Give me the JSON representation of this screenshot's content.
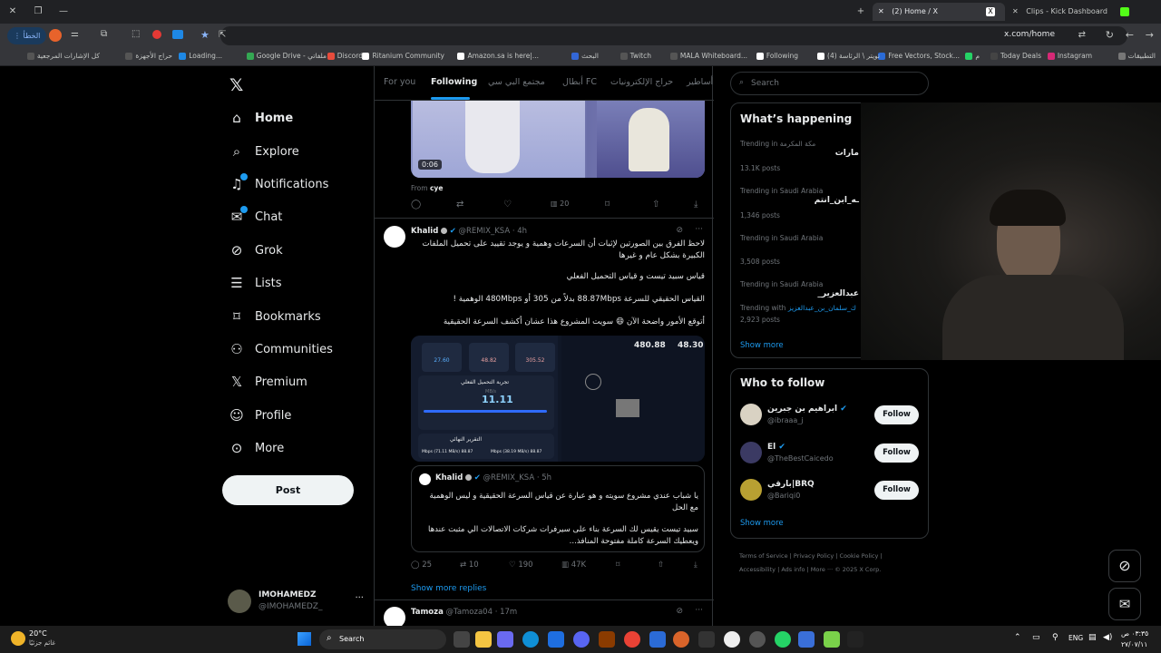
{
  "browser": {
    "tabs": [
      {
        "title": "(2) Home / X",
        "active": true
      },
      {
        "title": "Clips - Kick Dashboard",
        "active": false
      }
    ],
    "url": "x.com/home",
    "error_chip": "الخطأ",
    "bookmarks": [
      "التطبيقات",
      "Instagram",
      "Today Deals",
      "م",
      "Free Vectors, Stock...",
      "تويتر \\ الرئاسة (4)",
      "Following",
      "MALA Whiteboard...",
      "Twitch",
      "البحث",
      "Amazon.sa is here|...",
      "Ritanium Community",
      "Discord",
      "Google Drive - ملفاتي",
      "Loading...",
      "حراج الأجهزة",
      "كل الإشارات المرجعية"
    ]
  },
  "nav": {
    "items": [
      {
        "label": "Home",
        "icon": "home-icon"
      },
      {
        "label": "Explore",
        "icon": "search-icon"
      },
      {
        "label": "Notifications",
        "icon": "bell-icon"
      },
      {
        "label": "Chat",
        "icon": "mail-icon"
      },
      {
        "label": "Grok",
        "icon": "grok-icon"
      },
      {
        "label": "Lists",
        "icon": "list-icon"
      },
      {
        "label": "Bookmarks",
        "icon": "bookmark-icon"
      },
      {
        "label": "Communities",
        "icon": "communities-icon"
      },
      {
        "label": "Premium",
        "icon": "x-logo-icon"
      },
      {
        "label": "Profile",
        "icon": "person-icon"
      },
      {
        "label": "More",
        "icon": "more-circle-icon"
      }
    ],
    "post_label": "Post",
    "account": {
      "name": "IMOHAMEDZ",
      "handle": "@IMOHAMEDZ_",
      "more": "···"
    }
  },
  "feed": {
    "tabs": [
      "For you",
      "Following",
      "مجتمع البي سي",
      "أبطال FC",
      "حراج الإلكترونيات",
      "أساطير"
    ],
    "prev_tweet": {
      "duration": "0:06",
      "from_label": "From",
      "from_name": "cye",
      "views": "20"
    },
    "tweet": {
      "name": "Khalid",
      "handle": "@REMIX_KSA",
      "time": "· 4h",
      "lines": [
        "لاحظ الفرق بين الصورتين لإثبات أن السرعات وهمية و يوجد تقييد على تحميل الملفات الكبيرة بشكل عام و غيرها",
        "قياس سبيد تيست و قياس التحميل الفعلي",
        "القياس الحقيقي للسرعة 88.87Mbps بدلاً من 305 أو 480Mbps الوهمية !",
        "أتوقع الأمور واضحة الآن 😄 سويت المشروع هذا عشان أكشف السرعة الحقيقية"
      ],
      "image": {
        "stats": [
          "27.60",
          "48.82",
          "305.52"
        ],
        "card_title": "تجربة التحميل الفعلي",
        "speed": "11.11",
        "unit": "MB/s",
        "report_title": "التقرير النهائي",
        "report_left": "Mbps (71.11 MB/s) 88.87",
        "report_right": "Mbps (38.19 MB/s) 88.87",
        "download": "480.88",
        "upload": "48.30"
      },
      "quote": {
        "name": "Khalid",
        "handle": "@REMIX_KSA",
        "time": "· 5h",
        "text1": "يا شباب عندي مشروع سويته و هو عبارة عن قياس السرعة الحقيقية و ليس الوهمية مع الحل",
        "text2": "سبيد تيست يقيس لك السرعة بناء على سيرفرات شركات الاتصالات الي مثبت عندها ويعطيك السرعة كاملة مفتوحة المنافذ..."
      },
      "replies": "25",
      "reposts": "10",
      "likes": "190",
      "views": "47K",
      "show_more": "Show more replies"
    },
    "next_tweet": {
      "name": "Tamoza",
      "handle": "@Tamoza04",
      "time": "· 17m"
    }
  },
  "right": {
    "search_placeholder": "Search",
    "happening": {
      "title": "What’s happening",
      "trends": [
        {
          "context": "Trending in مكة المكرمة",
          "name": "مارات",
          "posts": "13.1K posts"
        },
        {
          "context": "Trending in Saudi Arabia",
          "name": "ـه_ابن_انتم",
          "posts": "1,346 posts"
        },
        {
          "context": "Trending in Saudi Arabia",
          "name": "",
          "posts": "3,508 posts"
        },
        {
          "context": "Trending in Saudi Arabia",
          "name": "عبدالعزير_",
          "posts": "2,923 posts",
          "with_label": "Trending with",
          "with": "ك_سلمان_بن_عبدالعزيز"
        }
      ],
      "show_more": "Show more"
    },
    "who_to_follow": {
      "title": "Who to follow",
      "accounts": [
        {
          "name": "ابراهيم بن جبرين",
          "handle": "@ibraaa_j"
        },
        {
          "name": "El",
          "handle": "@TheBestCaicedo"
        },
        {
          "name": "بارقي|BRQ",
          "handle": "@Bariqi0"
        }
      ],
      "follow_label": "Follow",
      "show_more": "Show more"
    },
    "footer": [
      "Terms of Service",
      "Privacy Policy",
      "Cookie Policy",
      "Accessibility",
      "Ads info",
      "More ···",
      "© 2025 X Corp."
    ]
  },
  "taskbar": {
    "weather_temp": "20°C",
    "weather_text": "غائم جزئيًا",
    "search": "Search",
    "lang": "ENG",
    "time": "٠٣:٣٥ ص",
    "date": "٢٧/٠٧/١١"
  }
}
